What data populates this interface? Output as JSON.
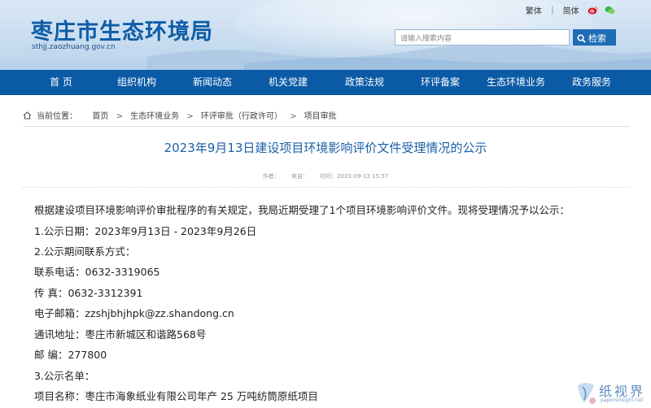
{
  "site": {
    "title": "枣庄市生态环境局",
    "url": "sthjj.zaozhuang.gov.cn"
  },
  "top_links": {
    "traditional": "繁体",
    "separator": "|",
    "simplified": "简体",
    "icons": [
      "weibo-icon",
      "wechat-icon"
    ]
  },
  "search": {
    "placeholder": "请输入搜索内容",
    "button_label": "检索"
  },
  "nav": {
    "items": [
      "首 页",
      "组织机构",
      "新闻动态",
      "机关党建",
      "政策法规",
      "环评备案",
      "生态环境业务",
      "政务服务"
    ]
  },
  "breadcrumb": {
    "label": "当前位置：",
    "items": [
      "首页",
      "生态环境业务",
      "环评审批（行政许可）",
      "项目审批"
    ],
    "separator": ">"
  },
  "article": {
    "title": "2023年9月13日建设项目环境影响评价文件受理情况的公示",
    "meta_author": "作者：",
    "meta_source": "来自：",
    "meta_time": "时间：2023-09-13 15:57",
    "paragraphs": [
      "根据建设项目环境影响评价审批程序的有关规定，我局近期受理了1个项目环境影响评价文件。现将受理情况予以公示：",
      "1.公示日期：2023年9月13日 - 2023年9月26日",
      "2.公示期间联系方式：",
      "联系电话：0632-3319065",
      "传 真：0632-3312391",
      "电子邮箱：zzshjbhjhpk@zz.shandong.cn",
      "通讯地址：枣庄市新城区和谐路568号",
      "邮 编：277800",
      "3.公示名单：",
      "项目名称：枣庄市海象纸业有限公司年产 25 万吨纺筒原纸项目"
    ]
  },
  "watermark": {
    "text": "纸视界",
    "url": "papersinsight.net"
  },
  "colors": {
    "brand_blue": "#0a5aa6",
    "title_blue": "#1a5fa8"
  }
}
